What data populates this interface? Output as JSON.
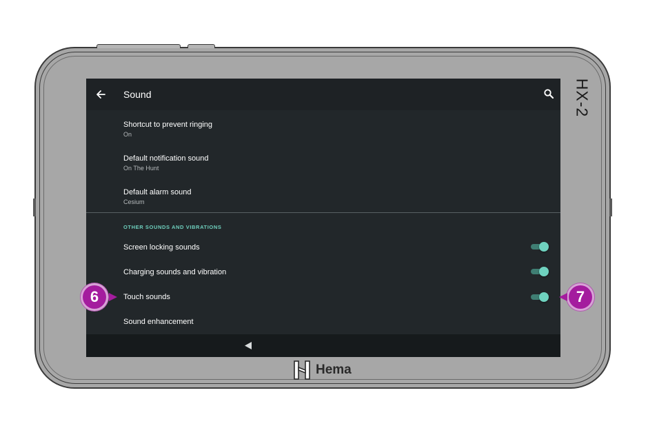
{
  "device": {
    "model": "HX-2",
    "brand": "Hema"
  },
  "appbar": {
    "title": "Sound"
  },
  "settings": [
    {
      "title": "Shortcut to prevent ringing",
      "subtitle": "On"
    },
    {
      "title": "Default notification sound",
      "subtitle": "On The Hunt"
    },
    {
      "title": "Default alarm sound",
      "subtitle": "Cesium"
    }
  ],
  "other_section": {
    "header": "OTHER SOUNDS AND VIBRATIONS",
    "items": [
      {
        "title": "Screen locking sounds",
        "enabled": true
      },
      {
        "title": "Charging sounds and vibration",
        "enabled": true
      },
      {
        "title": "Touch sounds",
        "enabled": true
      },
      {
        "title": "Sound enhancement"
      }
    ]
  },
  "callouts": [
    "6",
    "7"
  ],
  "colors": {
    "accent": "#6fd2bf",
    "callout": "#a41c9e",
    "screen_bg": "#22272a",
    "bezel": "#a7a7a7"
  },
  "icons": [
    "back-arrow-icon",
    "search-icon",
    "nav-back-icon",
    "hema-logo-icon"
  ]
}
